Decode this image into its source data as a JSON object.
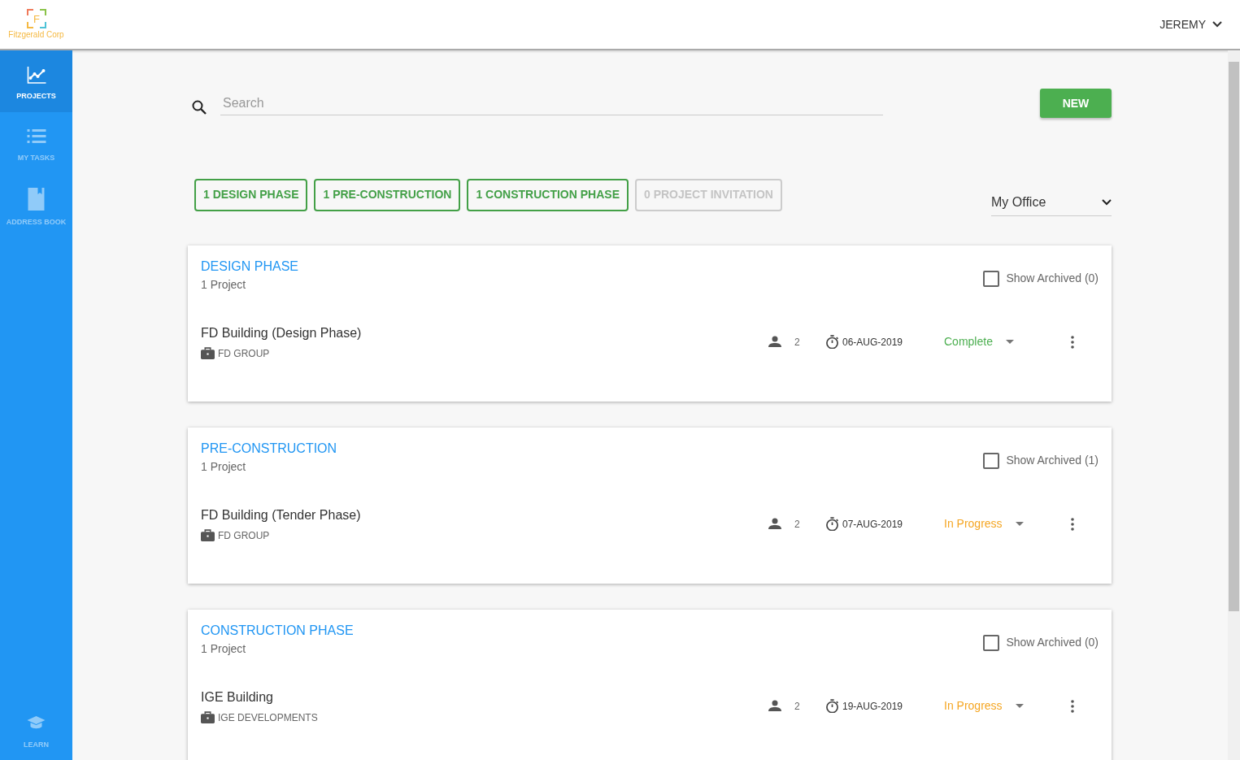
{
  "header": {
    "logo_letter": "F",
    "logo_text": "Fitzgerald Corp",
    "user": "JEREMY"
  },
  "sidebar": {
    "items": [
      {
        "label": "PROJECTS",
        "kind": "chart",
        "selected": true
      },
      {
        "label": "MY TASKS",
        "kind": "list",
        "selected": false
      },
      {
        "label": "ADDRESS BOOK",
        "kind": "book",
        "selected": false
      }
    ],
    "bottom_item": {
      "label": "LEARN",
      "kind": "cap",
      "selected": false
    }
  },
  "search": {
    "placeholder": "Search"
  },
  "new_button": "NEW",
  "filters": [
    {
      "label": "1 DESIGN PHASE",
      "disabled": false
    },
    {
      "label": "1 PRE-CONSTRUCTION",
      "disabled": false
    },
    {
      "label": "1 CONSTRUCTION PHASE",
      "disabled": false
    },
    {
      "label": "0 PROJECT INVITATION",
      "disabled": true
    }
  ],
  "office_select": "My Office",
  "sections": [
    {
      "title": "DESIGN PHASE",
      "count": "1 Project",
      "show_archived": {
        "label": "Show Archived (0)",
        "checked": false
      },
      "projects": [
        {
          "name": "FD Building (Design Phase)",
          "company": "FD GROUP",
          "members": "2",
          "date": "06-AUG-2019",
          "status": "Complete",
          "color": "#4caf50"
        }
      ]
    },
    {
      "title": "PRE-CONSTRUCTION",
      "count": "1 Project",
      "show_archived": {
        "label": "Show Archived (1)",
        "checked": false
      },
      "projects": [
        {
          "name": "FD Building (Tender Phase)",
          "company": "FD GROUP",
          "members": "2",
          "date": "07-AUG-2019",
          "status": "In Progress",
          "color": "#f5a623"
        }
      ]
    },
    {
      "title": "CONSTRUCTION PHASE",
      "count": "1 Project",
      "show_archived": {
        "label": "Show Archived (0)",
        "checked": false
      },
      "projects": [
        {
          "name": "IGE Building",
          "company": "IGE DEVELOPMENTS",
          "members": "2",
          "date": "19-AUG-2019",
          "status": "In Progress",
          "color": "#f5a623"
        }
      ]
    }
  ]
}
